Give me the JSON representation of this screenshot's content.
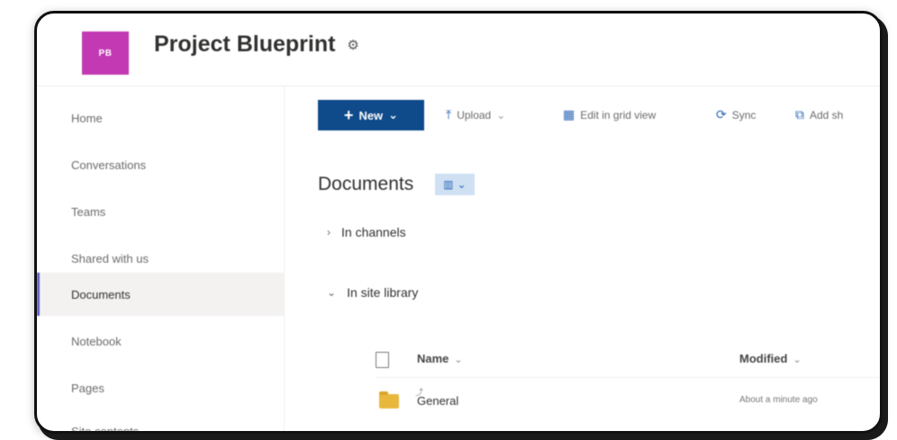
{
  "site": {
    "logo_initials": "PB",
    "title": "Project Blueprint",
    "settings_icon": "settings-icon"
  },
  "nav": {
    "items": [
      {
        "label": "Home"
      },
      {
        "label": "Conversations"
      },
      {
        "label": "Teams"
      },
      {
        "label": "Shared with us"
      },
      {
        "label": "Documents",
        "selected": true
      },
      {
        "label": "Notebook"
      },
      {
        "label": "Pages"
      },
      {
        "label": "Site contents"
      }
    ]
  },
  "commandbar": {
    "new_label": "New",
    "upload_label": "Upload",
    "grid_label": "Edit in grid view",
    "sync_label": "Sync",
    "add_shortcut_label": "Add sh"
  },
  "documents": {
    "title": "Documents",
    "sections": [
      {
        "label": "In channels",
        "expanded": false
      },
      {
        "label": "In site library",
        "expanded": true
      }
    ],
    "columns": {
      "name": "Name",
      "modified": "Modified"
    },
    "rows": [
      {
        "name": "General",
        "modified": "About a minute ago",
        "icon": "folder-icon"
      }
    ]
  },
  "colors": {
    "logo_bg": "#c239b3",
    "new_button_bg": "#0f4a8a",
    "accent": "#2b66b6",
    "folder": "#e8b83c"
  }
}
